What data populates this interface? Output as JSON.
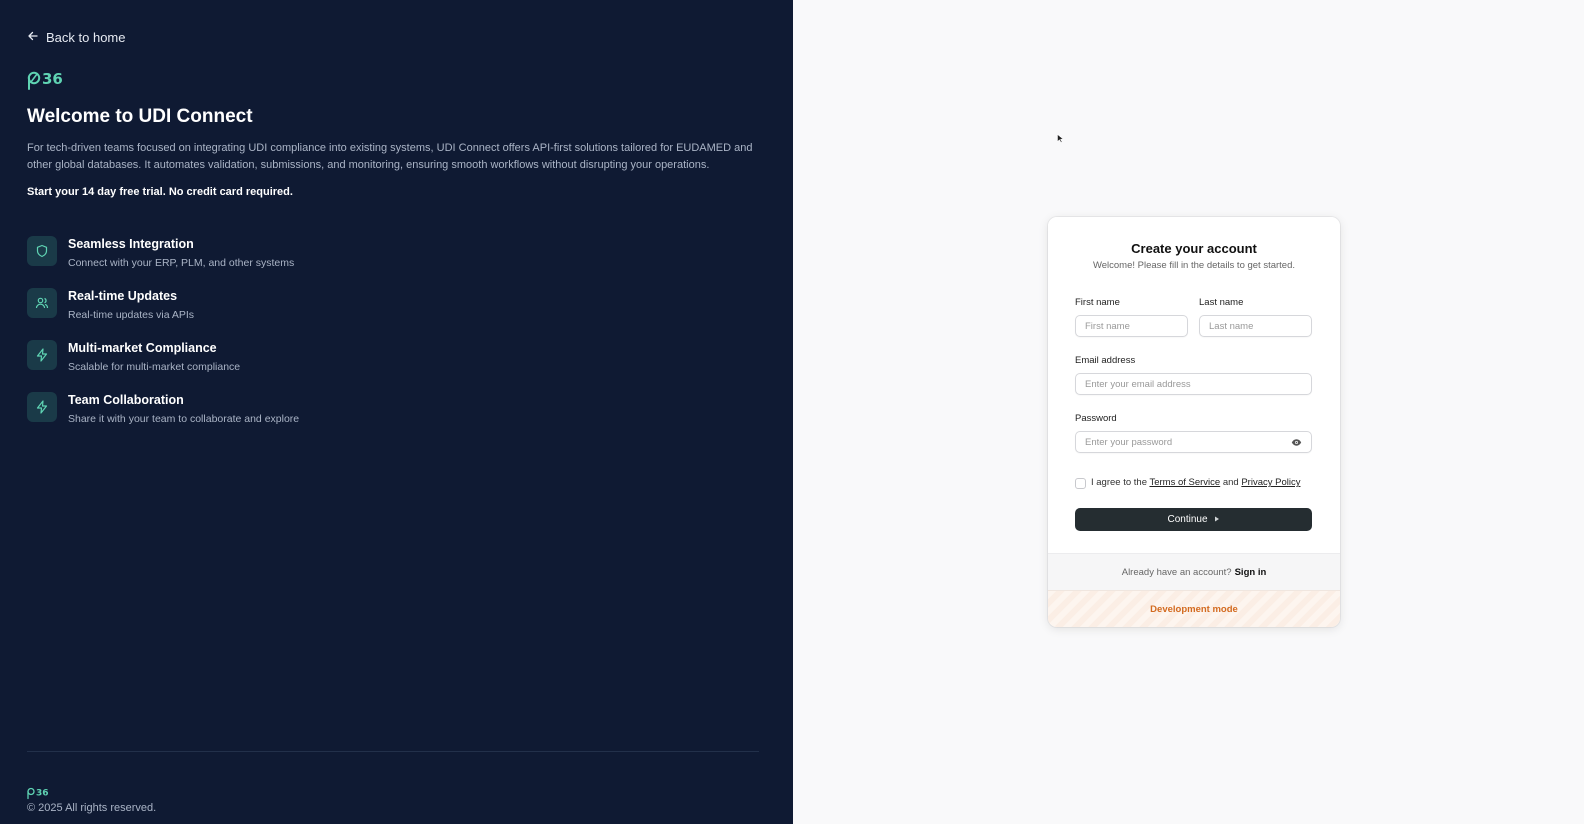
{
  "left": {
    "back_label": "Back to home",
    "logo_text": "p36",
    "title": "Welcome to UDI Connect",
    "description": "For tech-driven teams focused on integrating UDI compliance into existing systems, UDI Connect offers API-first solutions tailored for EUDAMED and other global databases. It automates validation, submissions, and monitoring, ensuring smooth workflows without disrupting your operations.",
    "trial_note": "Start your 14 day free trial. No credit card required.",
    "features": [
      {
        "icon": "shield-icon",
        "title": "Seamless Integration",
        "desc": "Connect with your ERP, PLM, and other systems"
      },
      {
        "icon": "users-icon",
        "title": "Real-time Updates",
        "desc": "Real-time updates via APIs"
      },
      {
        "icon": "zap-icon",
        "title": "Multi-market Compliance",
        "desc": "Scalable for multi-market compliance"
      },
      {
        "icon": "zap-icon",
        "title": "Team Collaboration",
        "desc": "Share it with your team to collaborate and explore"
      }
    ],
    "copyright": "© 2025 All rights reserved."
  },
  "card": {
    "title": "Create your account",
    "subtitle": "Welcome! Please fill in the details to get started.",
    "first_name_label": "First name",
    "first_name_placeholder": "First name",
    "last_name_label": "Last name",
    "last_name_placeholder": "Last name",
    "email_label": "Email address",
    "email_placeholder": "Enter your email address",
    "password_label": "Password",
    "password_placeholder": "Enter your password",
    "agree_prefix": "I agree to the",
    "terms_link": "Terms of Service",
    "agree_and": "and",
    "privacy_link": "Privacy Policy",
    "continue_label": "Continue",
    "have_account": "Already have an account?",
    "sign_in": "Sign in",
    "dev_mode": "Development mode"
  },
  "colors": {
    "left_bg": "#0f1a33",
    "accent": "#5fd3b3",
    "button": "#252d31",
    "dev_orange": "#d36a1f"
  }
}
